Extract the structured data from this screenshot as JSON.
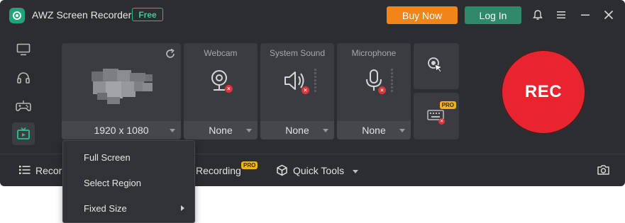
{
  "app": {
    "title": "AWZ Screen Recorder",
    "badge": "Free"
  },
  "header": {
    "buy_label": "Buy Now",
    "login_label": "Log In"
  },
  "modes": [
    {
      "name": "screen",
      "icon": "monitor-icon",
      "active": false
    },
    {
      "name": "audio",
      "icon": "headphones-icon",
      "active": false
    },
    {
      "name": "game",
      "icon": "gamepad-icon",
      "active": false
    },
    {
      "name": "tv",
      "icon": "tv-icon",
      "active": true
    }
  ],
  "panels": {
    "screen": {
      "resolution": "1920 x 1080"
    },
    "webcam": {
      "label": "Webcam",
      "value": "None"
    },
    "system_sound": {
      "label": "System Sound",
      "value": "None"
    },
    "microphone": {
      "label": "Microphone",
      "value": "None"
    }
  },
  "rec_label": "REC",
  "pro_label": "PRO",
  "bottom_bar": {
    "records_label": "Recor",
    "recording_label": "Recording",
    "quick_tools_label": "Quick Tools"
  },
  "dropdown": {
    "items": [
      {
        "label": "Full Screen",
        "submenu": false
      },
      {
        "label": "Select Region",
        "submenu": false
      },
      {
        "label": "Fixed Size",
        "submenu": true
      }
    ]
  },
  "colors": {
    "accent_green": "#2e8a6b",
    "buy_orange": "#f0861a",
    "rec_red": "#e8242f",
    "pro_yellow": "#f2b21f"
  }
}
